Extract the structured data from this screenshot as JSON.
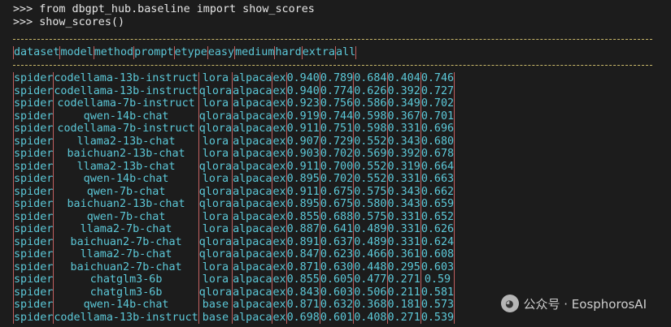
{
  "terminal": {
    "prompt": ">>>",
    "commands": [
      "from dbgpt_hub.baseline import show_scores",
      "show_scores()"
    ]
  },
  "colors": {
    "border": "#c9b86a",
    "separator": "#c26060",
    "cell_text": "#5cc8d8",
    "background": "#1c1c1c"
  },
  "table": {
    "headers": [
      "dataset",
      "model",
      "method",
      "prompt",
      "etype",
      "easy",
      "medium",
      "hard",
      "extra",
      "all"
    ],
    "rows": [
      [
        "spider",
        "codellama-13b-instruct",
        "lora",
        "alpaca",
        "ex",
        "0.940",
        "0.789",
        "0.684",
        "0.404",
        "0.746"
      ],
      [
        "spider",
        "codellama-13b-instruct",
        "qlora",
        "alpaca",
        "ex",
        "0.940",
        "0.774",
        "0.626",
        "0.392",
        "0.727"
      ],
      [
        "spider",
        "codellama-7b-instruct",
        "lora",
        "alpaca",
        "ex",
        "0.923",
        "0.756",
        "0.586",
        "0.349",
        "0.702"
      ],
      [
        "spider",
        "qwen-14b-chat",
        "qlora",
        "alpaca",
        "ex",
        "0.919",
        "0.744",
        "0.598",
        "0.367",
        "0.701"
      ],
      [
        "spider",
        "codellama-7b-instruct",
        "qlora",
        "alpaca",
        "ex",
        "0.911",
        "0.751",
        "0.598",
        "0.331",
        "0.696"
      ],
      [
        "spider",
        "llama2-13b-chat",
        "lora",
        "alpaca",
        "ex",
        "0.907",
        "0.729",
        "0.552",
        "0.343",
        "0.680"
      ],
      [
        "spider",
        "baichuan2-13b-chat",
        "lora",
        "alpaca",
        "ex",
        "0.903",
        "0.702",
        "0.569",
        "0.392",
        "0.678"
      ],
      [
        "spider",
        "llama2-13b-chat",
        "qlora",
        "alpaca",
        "ex",
        "0.911",
        "0.700",
        "0.552",
        "0.319",
        "0.664"
      ],
      [
        "spider",
        "qwen-14b-chat",
        "lora",
        "alpaca",
        "ex",
        "0.895",
        "0.702",
        "0.552",
        "0.331",
        "0.663"
      ],
      [
        "spider",
        "qwen-7b-chat",
        "qlora",
        "alpaca",
        "ex",
        "0.911",
        "0.675",
        "0.575",
        "0.343",
        "0.662"
      ],
      [
        "spider",
        "baichuan2-13b-chat",
        "qlora",
        "alpaca",
        "ex",
        "0.895",
        "0.675",
        "0.580",
        "0.343",
        "0.659"
      ],
      [
        "spider",
        "qwen-7b-chat",
        "lora",
        "alpaca",
        "ex",
        "0.855",
        "0.688",
        "0.575",
        "0.331",
        "0.652"
      ],
      [
        "spider",
        "llama2-7b-chat",
        "lora",
        "alpaca",
        "ex",
        "0.887",
        "0.641",
        "0.489",
        "0.331",
        "0.626"
      ],
      [
        "spider",
        "baichuan2-7b-chat",
        "qlora",
        "alpaca",
        "ex",
        "0.891",
        "0.637",
        "0.489",
        "0.331",
        "0.624"
      ],
      [
        "spider",
        "llama2-7b-chat",
        "qlora",
        "alpaca",
        "ex",
        "0.847",
        "0.623",
        "0.466",
        "0.361",
        "0.608"
      ],
      [
        "spider",
        "baichuan2-7b-chat",
        "lora",
        "alpaca",
        "ex",
        "0.871",
        "0.630",
        "0.448",
        "0.295",
        "0.603"
      ],
      [
        "spider",
        "chatglm3-6b",
        "lora",
        "alpaca",
        "ex",
        "0.855",
        "0.605",
        "0.477",
        "0.271",
        "0.59"
      ],
      [
        "spider",
        "chatglm3-6b",
        "qlora",
        "alpaca",
        "ex",
        "0.843",
        "0.603",
        "0.506",
        "0.211",
        "0.581"
      ],
      [
        "spider",
        "qwen-14b-chat",
        "base",
        "alpaca",
        "ex",
        "0.871",
        "0.632",
        "0.368",
        "0.181",
        "0.573"
      ],
      [
        "spider",
        "codellama-13b-instruct",
        "base",
        "alpaca",
        "ex",
        "0.698",
        "0.601",
        "0.408",
        "0.271",
        "0.539"
      ]
    ]
  },
  "watermark": {
    "text": "公众号 · EosphorosAI",
    "icon": "wechat-icon"
  }
}
